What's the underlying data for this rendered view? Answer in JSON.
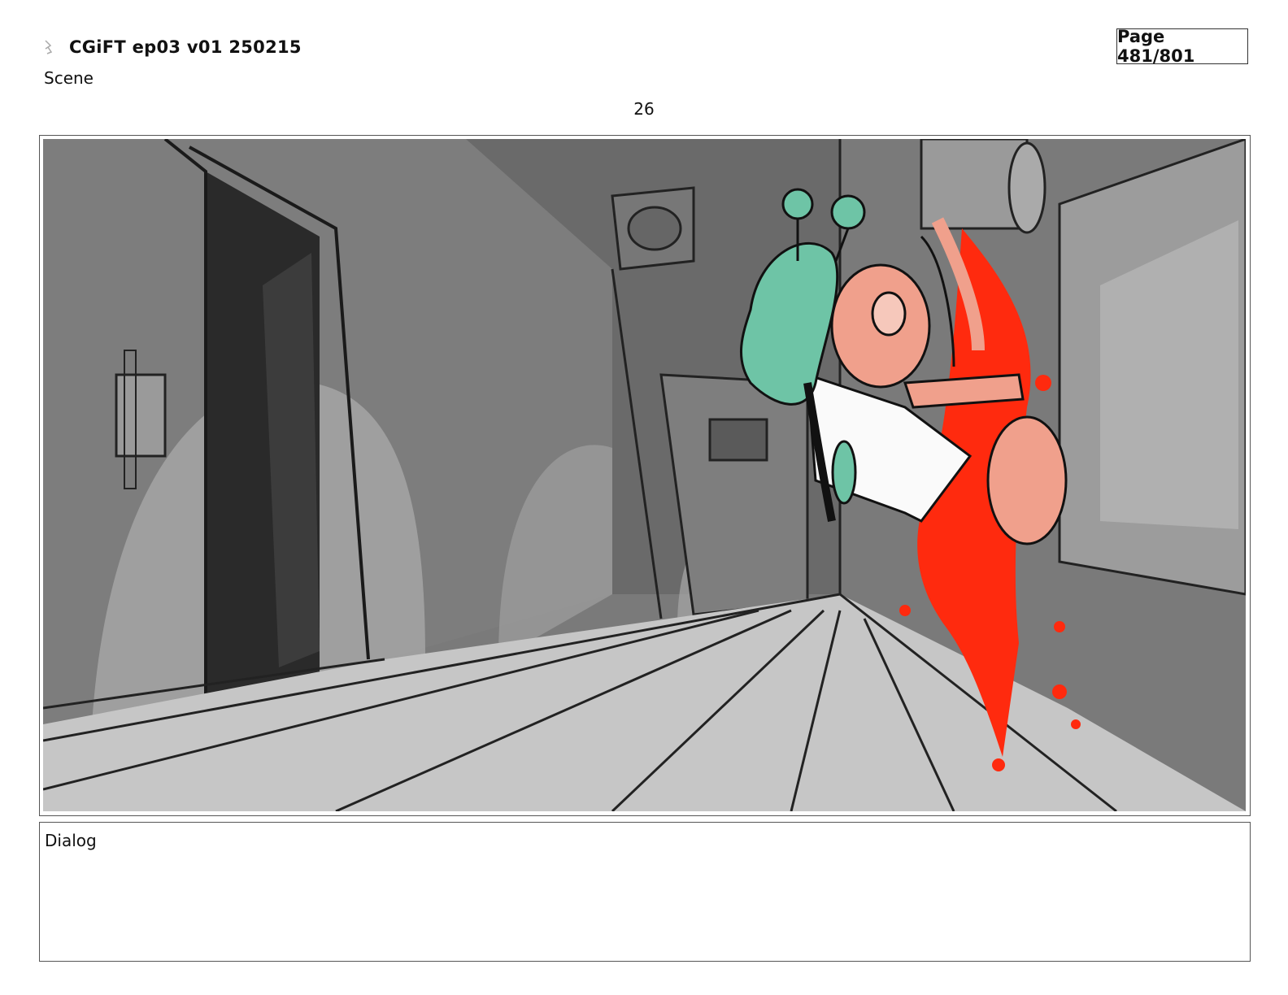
{
  "header": {
    "title": "CGiFT ep03 v01 250215",
    "page": "Page 481/801",
    "scene_label": "Scene",
    "scene_number": "26"
  },
  "panel": {
    "palette": {
      "wall_dark": "#5e5e5e",
      "wall_mid": "#8a8a8a",
      "wall_light": "#b4b4b4",
      "floor": "#c6c6c6",
      "doorway": "#2a2a2a",
      "green_character": "#6ec4a6",
      "pink_character": "#f0a08c",
      "splatter": "#ff2a0e"
    }
  },
  "dialog": {
    "label": "Dialog",
    "text": ""
  }
}
